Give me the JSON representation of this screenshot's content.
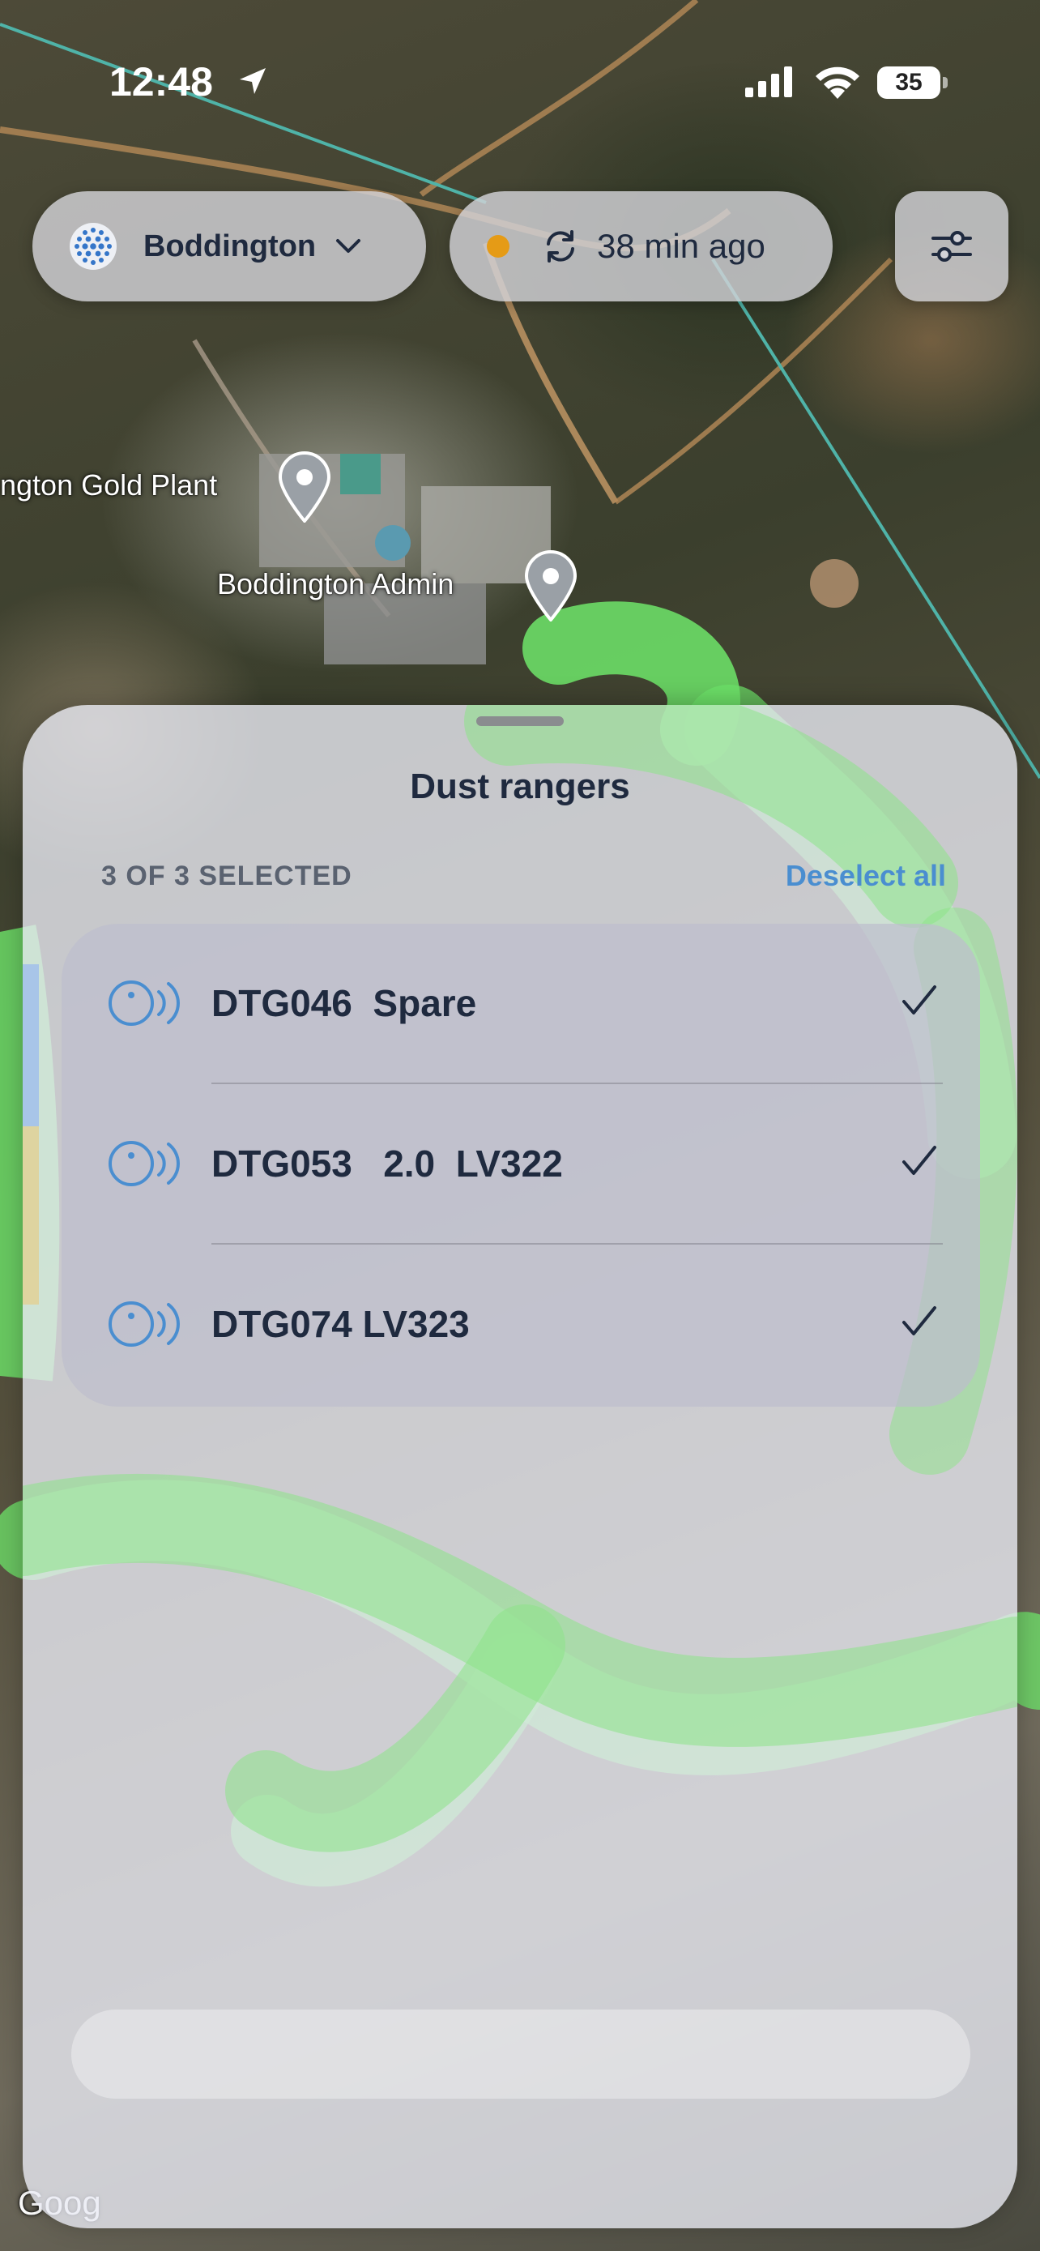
{
  "status_bar": {
    "time": "12:48",
    "battery": "35"
  },
  "header": {
    "site_name": "Boddington",
    "sync_status_color": "#e59b16",
    "sync_text": "38 min ago"
  },
  "map": {
    "places": [
      {
        "name": "ngton Gold Plant"
      },
      {
        "name": "Boddington Admin"
      }
    ],
    "attribution": "Goog"
  },
  "sheet": {
    "title": "Dust rangers",
    "selection_count": "3 OF 3 SELECTED",
    "deselect_label": "Deselect all",
    "items": [
      {
        "label": "DTG046  Spare",
        "selected": true
      },
      {
        "label": "DTG053   2.0  LV322",
        "selected": true
      },
      {
        "label": "DTG074 LV323",
        "selected": true
      }
    ]
  },
  "colors": {
    "accent": "#4a8ed0",
    "text": "#1f2a3f",
    "overlay_green": "#6ee66a"
  }
}
